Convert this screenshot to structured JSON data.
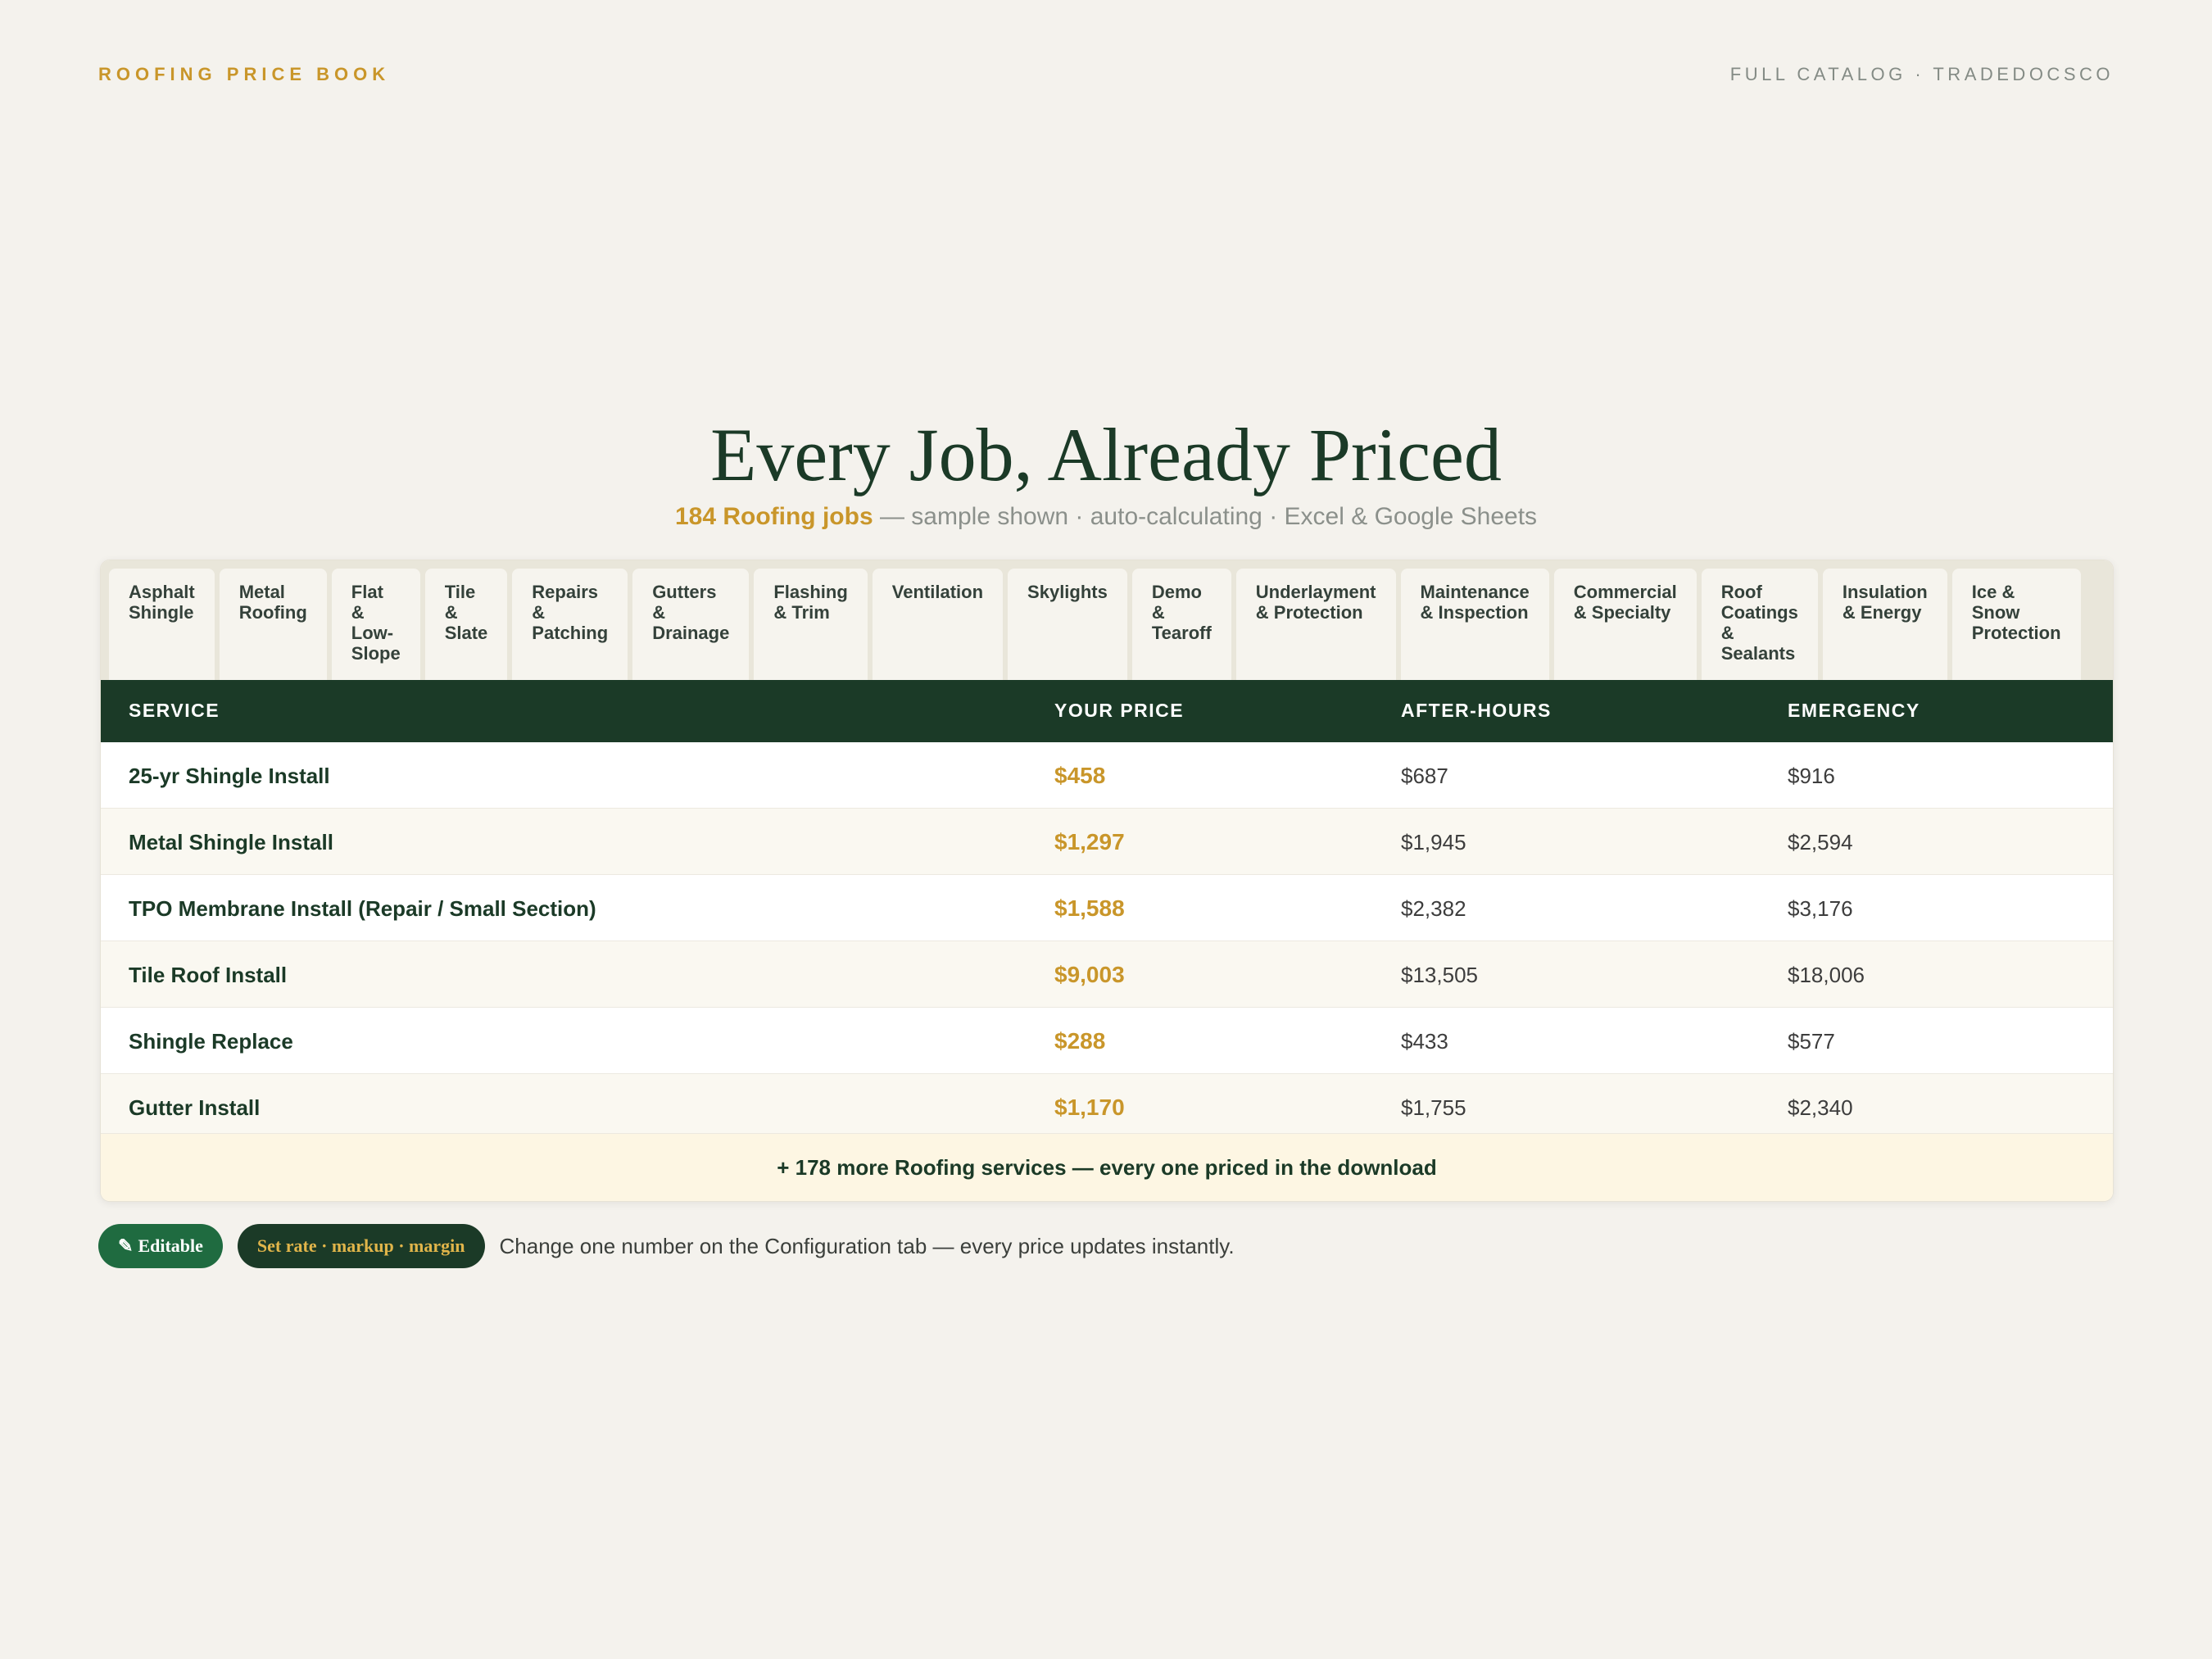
{
  "header": {
    "brand": "ROOFING PRICE BOOK",
    "catalog": "FULL CATALOG · TRADEDOCSCO"
  },
  "hero": {
    "title": "Every Job, Already Priced",
    "subtitle_accent": "184 Roofing jobs",
    "subtitle_rest": " — sample shown · auto-calculating · Excel & Google Sheets"
  },
  "tabs": [
    {
      "label": "Asphalt\nShingle"
    },
    {
      "label": "Metal\nRoofing"
    },
    {
      "label": "Flat\n&\nLow-\nSlope"
    },
    {
      "label": "Tile\n&\nSlate"
    },
    {
      "label": "Repairs\n&\nPatching"
    },
    {
      "label": "Gutters\n&\nDrainage"
    },
    {
      "label": "Flashing\n& Trim"
    },
    {
      "label": "Ventilation"
    },
    {
      "label": "Skylights"
    },
    {
      "label": "Demo\n&\nTearoff"
    },
    {
      "label": "Underlayment\n& Protection"
    },
    {
      "label": "Maintenance\n& Inspection"
    },
    {
      "label": "Commercial\n& Specialty"
    },
    {
      "label": "Roof\nCoatings\n&\nSealants"
    },
    {
      "label": "Insulation\n& Energy"
    },
    {
      "label": "Ice &\nSnow\nProtection"
    }
  ],
  "table": {
    "columns": [
      "SERVICE",
      "YOUR PRICE",
      "AFTER-HOURS",
      "EMERGENCY"
    ],
    "rows": [
      {
        "service": "25-yr Shingle Install",
        "price": "$458",
        "after_hours": "$687",
        "emergency": "$916"
      },
      {
        "service": "Metal Shingle Install",
        "price": "$1,297",
        "after_hours": "$1,945",
        "emergency": "$2,594"
      },
      {
        "service": "TPO Membrane Install (Repair / Small Section)",
        "price": "$1,588",
        "after_hours": "$2,382",
        "emergency": "$3,176"
      },
      {
        "service": "Tile Roof Install",
        "price": "$9,003",
        "after_hours": "$13,505",
        "emergency": "$18,006"
      },
      {
        "service": "Shingle Replace",
        "price": "$288",
        "after_hours": "$433",
        "emergency": "$577"
      },
      {
        "service": "Gutter Install",
        "price": "$1,170",
        "after_hours": "$1,755",
        "emergency": "$2,340"
      }
    ],
    "more": "+ 178 more Roofing services — every one priced in the download"
  },
  "footer": {
    "editable_icon": "pencil-icon",
    "editable_label": "Editable",
    "rate_label": "Set rate · markup · margin",
    "note": "Change one number on the Configuration tab — every price updates instantly."
  },
  "colors": {
    "accent": "#c9962a",
    "dark_green": "#1b3a27",
    "badge_green": "#1f6b40"
  }
}
